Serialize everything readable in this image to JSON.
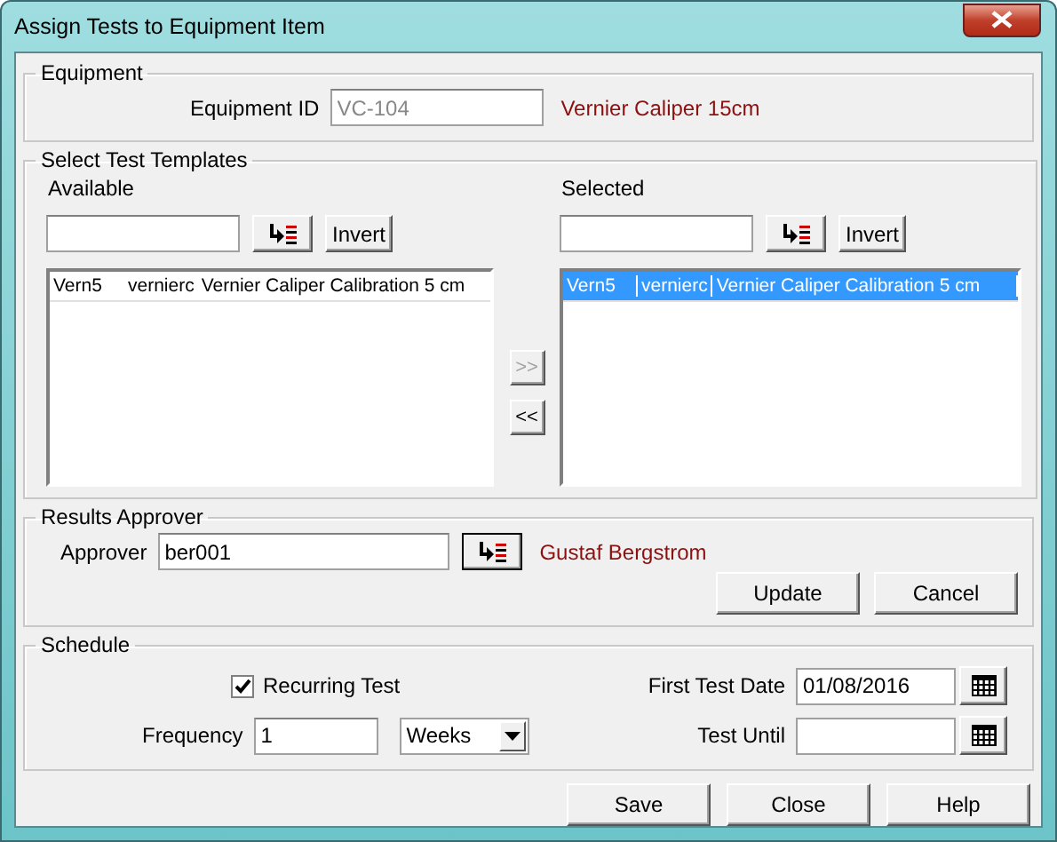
{
  "window": {
    "title": "Assign Tests to Equipment Item"
  },
  "equipment": {
    "legend": "Equipment",
    "id_label": "Equipment ID",
    "id_value": "VC-104",
    "id_disabled": true,
    "description": "Vernier Caliper 15cm"
  },
  "templates": {
    "legend": "Select Test Templates",
    "lists": [
      {
        "label": "Available",
        "invert": "Invert",
        "rows": [
          {
            "cells": [
              "Vern5",
              "vernierc",
              "Vernier Caliper Calibration 5 cm"
            ],
            "selected": false
          }
        ]
      },
      {
        "label": "Selected",
        "invert": "Invert",
        "rows": [
          {
            "cells": [
              "Vern5",
              "vernierc",
              "Vernier Caliper Calibration 5 cm"
            ],
            "selected": true
          }
        ]
      }
    ],
    "move_buttons": [
      {
        "label": ">>",
        "disabled": true
      },
      {
        "label": "<<",
        "disabled": false
      }
    ]
  },
  "approver": {
    "legend": "Results Approver",
    "label": "Approver",
    "value": "ber001",
    "name": "Gustaf Bergstrom",
    "buttons": [
      "Update",
      "Cancel"
    ]
  },
  "schedule": {
    "legend": "Schedule",
    "recurring": {
      "label": "Recurring Test",
      "checked": true
    },
    "frequency_label": "Frequency",
    "frequency": "1",
    "unit": "Weeks",
    "first_date_label": "First Test Date",
    "first_date": "01/08/2016",
    "until_label": "Test Until"
  },
  "buttons": [
    "Save",
    "Close",
    "Help"
  ]
}
